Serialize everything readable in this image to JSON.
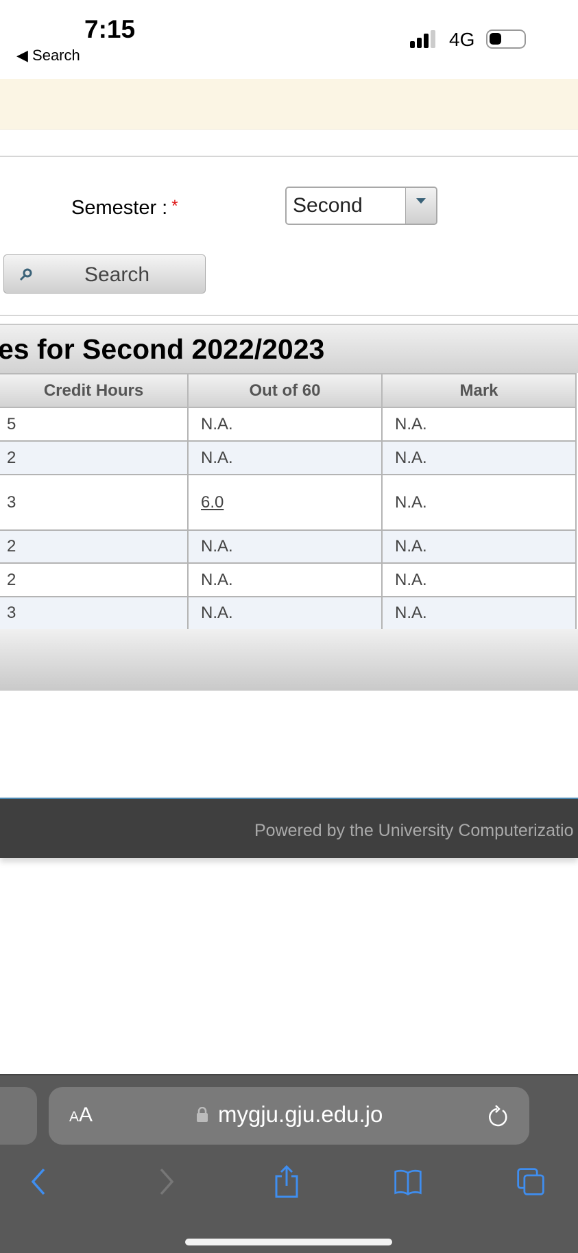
{
  "status_bar": {
    "time": "7:15",
    "back_label": "◀ Search",
    "network": "4G",
    "battery_level": 0.35
  },
  "form": {
    "semester_label": "Semester :",
    "required_mark": "*",
    "semester_value": "Second",
    "search_label": "Search"
  },
  "results": {
    "title": "es for Second 2022/2023",
    "columns": [
      "Credit Hours",
      "Out of 60",
      "Mark"
    ],
    "rows": [
      {
        "credit": "5",
        "out_of_60": "N.A.",
        "mark": "N.A."
      },
      {
        "credit": "2",
        "out_of_60": "N.A.",
        "mark": "N.A."
      },
      {
        "credit": "3",
        "out_of_60": "6.0",
        "mark": "N.A."
      },
      {
        "credit": "2",
        "out_of_60": "N.A.",
        "mark": "N.A."
      },
      {
        "credit": "2",
        "out_of_60": "N.A.",
        "mark": "N.A."
      },
      {
        "credit": "3",
        "out_of_60": "N.A.",
        "mark": "N.A."
      }
    ]
  },
  "footer": {
    "text": "Powered by the University Computerizatio"
  },
  "browser": {
    "text_size_label_small": "A",
    "text_size_label_large": "A",
    "url": "mygju.gju.edu.jo",
    "accent": "#3f8ef0"
  }
}
